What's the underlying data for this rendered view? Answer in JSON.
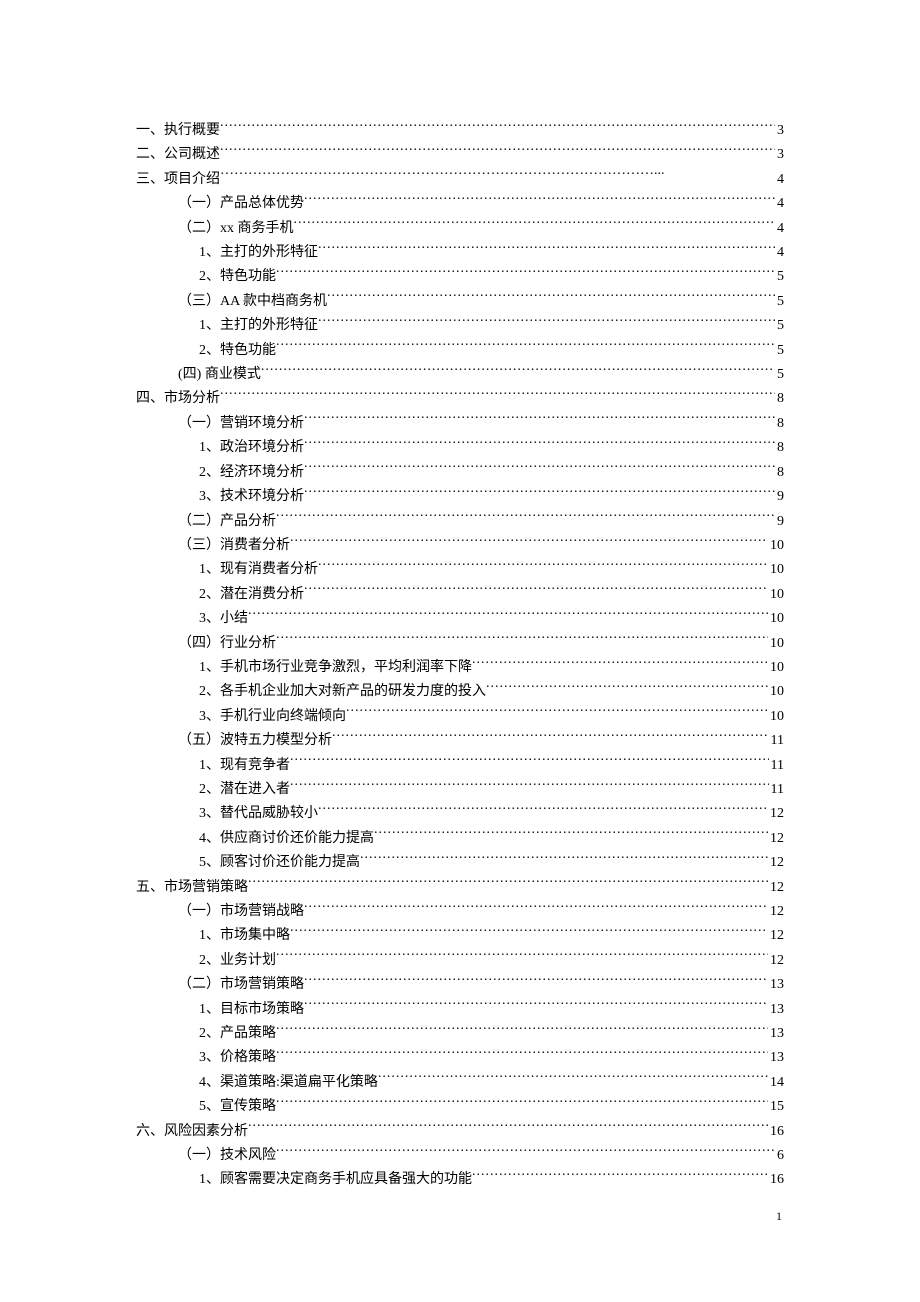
{
  "toc": [
    {
      "indent": 0,
      "label": "一、执行概要",
      "page": "3",
      "leader": "dot"
    },
    {
      "indent": 0,
      "label": "二、公司概述",
      "page": "3",
      "leader": "dot"
    },
    {
      "indent": 0,
      "label": "三、项目介绍",
      "page": "4",
      "leader": "ellipsis"
    },
    {
      "indent": 1,
      "label": "（一）产品总体优势",
      "page": "4",
      "leader": "dot"
    },
    {
      "indent": 1,
      "label": "（二）xx 商务手机",
      "page": "4",
      "leader": "dot"
    },
    {
      "indent": 2,
      "label": "1、主打的外形特征",
      "page": "4",
      "leader": "dot"
    },
    {
      "indent": 2,
      "label": "2、特色功能",
      "page": "5",
      "leader": "dot"
    },
    {
      "indent": 1,
      "label": "（三）AA 款中档商务机",
      "page": "5",
      "leader": "dot"
    },
    {
      "indent": 2,
      "label": "1、主打的外形特征",
      "page": "5",
      "leader": "dot"
    },
    {
      "indent": 2,
      "label": "2、特色功能",
      "page": "5",
      "leader": "dot"
    },
    {
      "indent": 1,
      "label": "(四) 商业模式",
      "page": "5",
      "leader": "dot"
    },
    {
      "indent": 0,
      "label": "四、市场分析",
      "page": "8",
      "leader": "dot"
    },
    {
      "indent": 1,
      "label": "（一）营销环境分析",
      "page": "8",
      "leader": "dot"
    },
    {
      "indent": 2,
      "label": "1、政治环境分析",
      "page": "8",
      "leader": "dot"
    },
    {
      "indent": 2,
      "label": "2、经济环境分析",
      "page": "8",
      "leader": "dot"
    },
    {
      "indent": 2,
      "label": "3、技术环境分析",
      "page": "9",
      "leader": "dot"
    },
    {
      "indent": 1,
      "label": "（二）产品分析",
      "page": "9",
      "leader": "dot"
    },
    {
      "indent": 1,
      "label": "（三）消费者分析",
      "page": "10",
      "leader": "dot"
    },
    {
      "indent": 2,
      "label": "1、现有消费者分析",
      "page": "10",
      "leader": "dot"
    },
    {
      "indent": 2,
      "label": "2、潜在消费分析",
      "page": "10",
      "leader": "dot"
    },
    {
      "indent": 2,
      "label": "3、小结",
      "page": "10",
      "leader": "dot"
    },
    {
      "indent": 1,
      "label": "（四）行业分析",
      "page": "10",
      "leader": "dot"
    },
    {
      "indent": 2,
      "label": "1、手机市场行业竞争激烈，平均利润率下降",
      "page": "10",
      "leader": "dot"
    },
    {
      "indent": 2,
      "label": "2、各手机企业加大对新产品的研发力度的投入",
      "page": "10",
      "leader": "dot"
    },
    {
      "indent": 2,
      "label": "3、手机行业向终端倾向",
      "page": "10",
      "leader": "dot"
    },
    {
      "indent": 1,
      "label": "（五）波特五力模型分析",
      "page": "11",
      "leader": "dot"
    },
    {
      "indent": 2,
      "label": "1、现有竞争者",
      "page": "11",
      "leader": "dot"
    },
    {
      "indent": 2,
      "label": "2、潜在进入者",
      "page": "11",
      "leader": "dot"
    },
    {
      "indent": 2,
      "label": "3、替代品威胁较小",
      "page": "12",
      "leader": "dot"
    },
    {
      "indent": 2,
      "label": "4、供应商讨价还价能力提高",
      "page": "12",
      "leader": "dot"
    },
    {
      "indent": 2,
      "label": "5、顾客讨价还价能力提高",
      "page": "12",
      "leader": "dot"
    },
    {
      "indent": 0,
      "label": "五、市场营销策略",
      "page": "12",
      "leader": "dot"
    },
    {
      "indent": 1,
      "label": "（一）市场营销战略",
      "page": "12",
      "leader": "dot"
    },
    {
      "indent": 2,
      "label": "1、市场集中略",
      "page": "12",
      "leader": "dot"
    },
    {
      "indent": 2,
      "label": "2、业务计划",
      "page": "12",
      "leader": "dot"
    },
    {
      "indent": 1,
      "label": "（二）市场营销策略",
      "page": "13",
      "leader": "dot"
    },
    {
      "indent": 2,
      "label": "1、目标市场策略",
      "page": "13",
      "leader": "dot"
    },
    {
      "indent": 2,
      "label": "2、产品策略",
      "page": "13",
      "leader": "dot"
    },
    {
      "indent": 2,
      "label": "3、价格策略",
      "page": "13",
      "leader": "dot"
    },
    {
      "indent": 2,
      "label": "4、渠道策略:渠道扁平化策略 ",
      "page": "14",
      "leader": "dot"
    },
    {
      "indent": 2,
      "label": "5、宣传策略",
      "page": "15",
      "leader": "dot"
    },
    {
      "indent": 0,
      "label": "六、风险因素分析",
      "page": "16",
      "leader": "dot"
    },
    {
      "indent": 1,
      "label": "（一）技术风险",
      "page": "6",
      "leader": "dot"
    },
    {
      "indent": 2,
      "label": "1、顾客需要决定商务手机应具备强大的功能",
      "page": "16",
      "leader": "dot"
    }
  ],
  "pageNumber": "1"
}
